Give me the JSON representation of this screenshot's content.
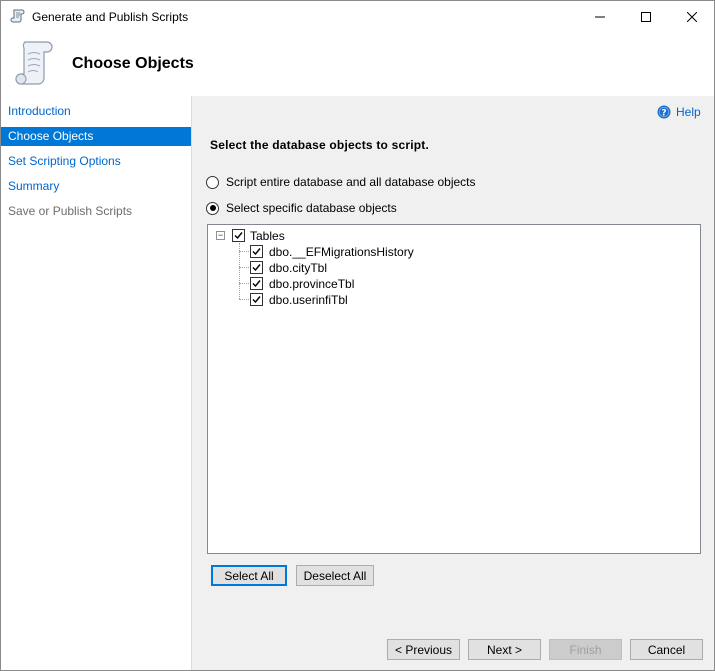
{
  "window": {
    "title": "Generate and Publish Scripts"
  },
  "header": {
    "title": "Choose Objects"
  },
  "nav": {
    "items": [
      {
        "label": "Introduction",
        "state": "link"
      },
      {
        "label": "Choose Objects",
        "state": "selected"
      },
      {
        "label": "Set Scripting Options",
        "state": "link"
      },
      {
        "label": "Summary",
        "state": "link"
      },
      {
        "label": "Save or Publish Scripts",
        "state": "disabled"
      }
    ]
  },
  "main": {
    "help_label": "Help",
    "section_title": "Select the database objects to script.",
    "radio_entire": {
      "label": "Script entire database and all database objects",
      "checked": false
    },
    "radio_specific": {
      "label": "Select specific database objects",
      "checked": true
    },
    "tree": {
      "root": {
        "label": "Tables",
        "checked": true,
        "expanded": true
      },
      "children": [
        {
          "label": "dbo.__EFMigrationsHistory",
          "checked": true
        },
        {
          "label": "dbo.cityTbl",
          "checked": true
        },
        {
          "label": "dbo.provinceTbl",
          "checked": true
        },
        {
          "label": "dbo.userinfiTbl",
          "checked": true
        }
      ]
    },
    "select_all_label": "Select All",
    "deselect_all_label": "Deselect All"
  },
  "footer": {
    "previous_label": "< Previous",
    "next_label": "Next >",
    "finish_label": "Finish",
    "cancel_label": "Cancel"
  },
  "colors": {
    "accent": "#0078d7",
    "link": "#0066cc",
    "disabled_text": "#6d6d6d"
  }
}
